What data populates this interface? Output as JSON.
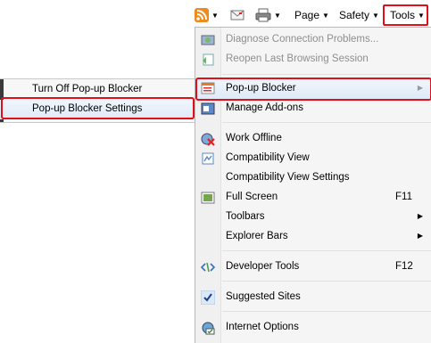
{
  "toolbar": {
    "page_label": "Page",
    "safety_label": "Safety",
    "tools_label": "Tools"
  },
  "menu": {
    "items": [
      {
        "label": "Diagnose Connection Problems...",
        "disabled": true
      },
      {
        "label": "Reopen Last Browsing Session",
        "disabled": true
      },
      {
        "label": "Pop-up Blocker",
        "has_submenu": true,
        "highlighted": true
      },
      {
        "label": "Manage Add-ons"
      },
      {
        "label": "Work Offline"
      },
      {
        "label": "Compatibility View"
      },
      {
        "label": "Compatibility View Settings"
      },
      {
        "label": "Full Screen",
        "shortcut": "F11"
      },
      {
        "label": "Toolbars",
        "has_submenu": true
      },
      {
        "label": "Explorer Bars",
        "has_submenu": true
      },
      {
        "label": "Developer Tools",
        "shortcut": "F12"
      },
      {
        "label": "Suggested Sites",
        "checked": true
      },
      {
        "label": "Internet Options"
      }
    ]
  },
  "submenu": {
    "items": [
      {
        "label": "Turn Off Pop-up Blocker"
      },
      {
        "label": "Pop-up Blocker Settings",
        "highlighted": true
      }
    ]
  },
  "colors": {
    "accent_red": "#e0101a"
  }
}
